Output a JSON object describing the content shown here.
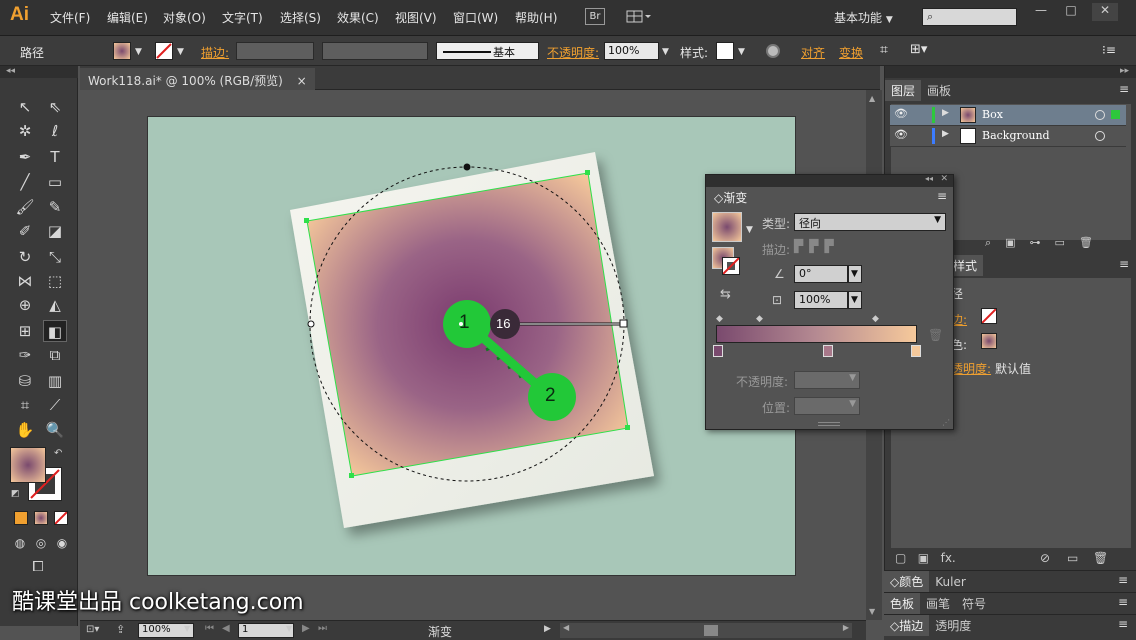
{
  "app": {
    "logo": "Ai"
  },
  "menu": [
    "文件(F)",
    "编辑(E)",
    "对象(O)",
    "文字(T)",
    "选择(S)",
    "效果(C)",
    "视图(V)",
    "窗口(W)",
    "帮助(H)"
  ],
  "bridge_label": "Br",
  "workspace": "基本功能",
  "window_controls": {
    "minimize": "—",
    "maximize": "□",
    "close": "✕"
  },
  "control_bar": {
    "object_type": "路径",
    "stroke_label": "描边:",
    "stroke_style": "基本",
    "opacity_label": "不透明度:",
    "opacity_value": "100%",
    "style_label": "样式:",
    "align_label": "对齐",
    "transform_label": "变换"
  },
  "document": {
    "tab_title": "Work118.ai* @ 100% (RGB/预览)",
    "close": "×"
  },
  "layers_panel": {
    "tabs": [
      "图层",
      "画板"
    ],
    "layers": [
      {
        "name": "Box",
        "color": "#2dc83c",
        "selected": true
      },
      {
        "name": "Background",
        "color": "#3c7cff",
        "selected": false
      }
    ]
  },
  "appearance_panel": {
    "tab": "样式",
    "title_fragment": "径",
    "stroke_fragment": "边:",
    "fill_fragment": "色:",
    "opacity_fragment": "透明度:",
    "opacity_value": "默认值"
  },
  "gradient_panel": {
    "title": "渐变",
    "type_label": "类型:",
    "type_value": "径向",
    "stroke_label": "描边:",
    "angle_value": "0°",
    "aspect_value": "100%",
    "opacity_label": "不透明度:",
    "location_label": "位置:",
    "gradient_colors": [
      "#7a4a6e",
      "#f6c99b"
    ]
  },
  "canvas_annotations": {
    "marker1": "1",
    "marker2": "2",
    "counter": "16"
  },
  "bottom_panels": {
    "row1": [
      "颜色",
      "Kuler"
    ],
    "row2": [
      "色板",
      "画笔",
      "符号"
    ],
    "row3": [
      "描边",
      "透明度"
    ]
  },
  "statusbar": {
    "zoom": "100%",
    "page": "1",
    "status": "渐变"
  },
  "watermark": "酷课堂出品 coolketang.com"
}
